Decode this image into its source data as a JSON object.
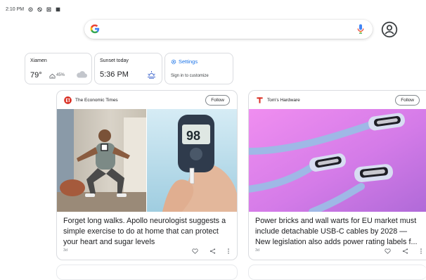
{
  "status_bar": {
    "time": "2:10 PM"
  },
  "search": {
    "placeholder": ""
  },
  "weather": {
    "location": "Xiamen",
    "temperature": "79°",
    "humidity": "45%"
  },
  "sunset": {
    "title": "Sunset today",
    "time": "5:36 PM"
  },
  "settings_card": {
    "title": "Settings",
    "subtitle": "Sign in to customize"
  },
  "feed": [
    {
      "source": "The Economic Times",
      "follow_label": "Follow",
      "headline": "Forget long walks. Apollo neurologist suggests a simple exercise to do at home that can protect your heart and sugar levels",
      "age": "3d",
      "glucose_display": "98"
    },
    {
      "source": "Tom's Hardware",
      "follow_label": "Follow",
      "headline": "Power bricks and wall warts for EU market must include detachable USB-C cables by 2028 — New legislation also adds power rating labels f...",
      "age": "3d"
    }
  ],
  "colors": {
    "accent": "#1a73e8",
    "brand_red": "#d93025",
    "card_border": "#dadce0"
  }
}
